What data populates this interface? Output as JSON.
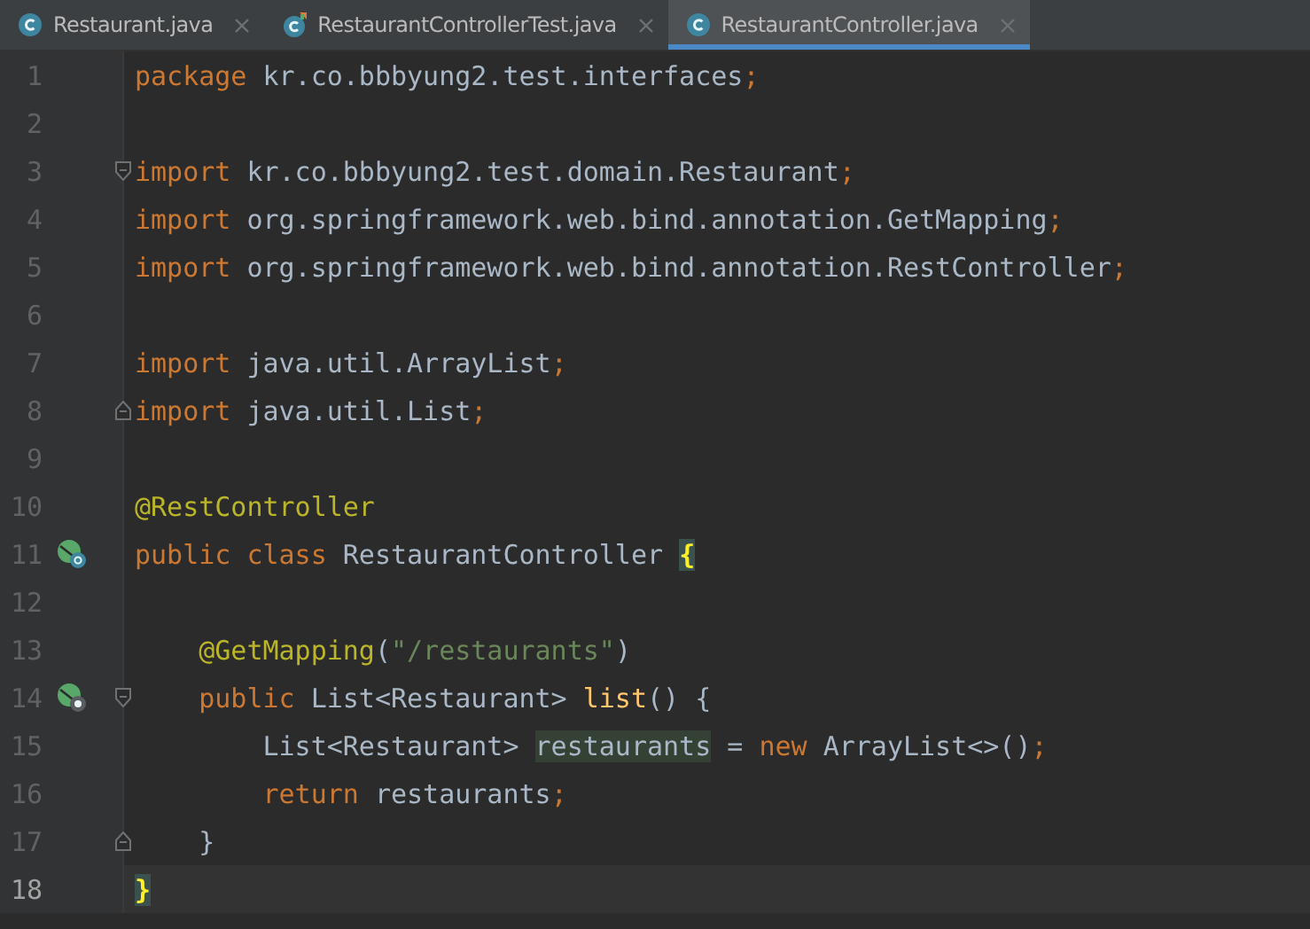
{
  "tabs": [
    {
      "label": "Restaurant.java",
      "kind": "class",
      "selected": false
    },
    {
      "label": "RestaurantControllerTest.java",
      "kind": "test-class",
      "selected": false
    },
    {
      "label": "RestaurantController.java",
      "kind": "class",
      "selected": true
    }
  ],
  "lines": [
    {
      "number": "1",
      "current": false,
      "tokens": [
        {
          "text": "package",
          "kind": "keyword"
        },
        {
          "text": " kr.co.bbbyung2.test.interfaces",
          "kind": "plain"
        },
        {
          "text": ";",
          "kind": "keyword"
        }
      ]
    },
    {
      "number": "2",
      "current": false
    },
    {
      "number": "3",
      "current": false,
      "fold": {
        "kind": "start"
      },
      "tokens": [
        {
          "text": "import",
          "kind": "keyword"
        },
        {
          "text": " kr.co.bbbyung2.test.domain.Restaurant",
          "kind": "plain"
        },
        {
          "text": ";",
          "kind": "keyword"
        }
      ]
    },
    {
      "number": "4",
      "current": false,
      "tokens": [
        {
          "text": "import",
          "kind": "keyword"
        },
        {
          "text": " org.springframework.web.bind.annotation.GetMapping",
          "kind": "plain"
        },
        {
          "text": ";",
          "kind": "keyword"
        }
      ]
    },
    {
      "number": "5",
      "current": false,
      "tokens": [
        {
          "text": "import",
          "kind": "keyword"
        },
        {
          "text": " org.springframework.web.bind.annotation.RestController",
          "kind": "plain"
        },
        {
          "text": ";",
          "kind": "keyword"
        }
      ]
    },
    {
      "number": "6",
      "current": false
    },
    {
      "number": "7",
      "current": false,
      "tokens": [
        {
          "text": "import",
          "kind": "keyword"
        },
        {
          "text": " java.util.ArrayList",
          "kind": "plain"
        },
        {
          "text": ";",
          "kind": "keyword"
        }
      ]
    },
    {
      "number": "8",
      "current": false,
      "fold": {
        "kind": "end"
      },
      "tokens": [
        {
          "text": "import",
          "kind": "keyword"
        },
        {
          "text": " java.util.List",
          "kind": "plain"
        },
        {
          "text": ";",
          "kind": "keyword"
        }
      ]
    },
    {
      "number": "9",
      "current": false
    },
    {
      "number": "10",
      "current": false,
      "tokens": [
        {
          "text": "@RestController",
          "kind": "annotation"
        }
      ]
    },
    {
      "number": "11",
      "current": false,
      "marker": {
        "kind": "class"
      },
      "tokens": [
        {
          "text": "public class",
          "kind": "keyword"
        },
        {
          "text": " RestaurantController ",
          "kind": "plain"
        },
        {
          "text": "{",
          "kind": "brace-match"
        }
      ]
    },
    {
      "number": "12",
      "current": false
    },
    {
      "number": "13",
      "current": false,
      "tokens": [
        {
          "text": "    @GetMapping",
          "kind": "annotation"
        },
        {
          "text": "(",
          "kind": "plain"
        },
        {
          "text": "\"/restaurants\"",
          "kind": "string"
        },
        {
          "text": ")",
          "kind": "plain"
        }
      ]
    },
    {
      "number": "14",
      "current": false,
      "marker": {
        "kind": "method"
      },
      "fold": {
        "kind": "start"
      },
      "tokens": [
        {
          "text": "    public",
          "kind": "keyword"
        },
        {
          "text": " List<Restaurant> ",
          "kind": "plain"
        },
        {
          "text": "list",
          "kind": "method"
        },
        {
          "text": "() {",
          "kind": "plain"
        }
      ]
    },
    {
      "number": "15",
      "current": false,
      "tokens": [
        {
          "text": "        List<Restaurant> ",
          "kind": "plain"
        },
        {
          "text": "restaurants",
          "kind": "usage"
        },
        {
          "text": " = ",
          "kind": "plain"
        },
        {
          "text": "new",
          "kind": "keyword"
        },
        {
          "text": " ArrayList<>()",
          "kind": "plain"
        },
        {
          "text": ";",
          "kind": "keyword"
        }
      ]
    },
    {
      "number": "16",
      "current": false,
      "tokens": [
        {
          "text": "        return",
          "kind": "keyword"
        },
        {
          "text": " restaurants",
          "kind": "plain"
        },
        {
          "text": ";",
          "kind": "keyword"
        }
      ]
    },
    {
      "number": "17",
      "current": false,
      "fold": {
        "kind": "end"
      },
      "tokens": [
        {
          "text": "    }",
          "kind": "plain"
        }
      ]
    },
    {
      "number": "18",
      "current": true,
      "tokens": [
        {
          "text": "}",
          "kind": "brace-match"
        }
      ]
    }
  ]
}
